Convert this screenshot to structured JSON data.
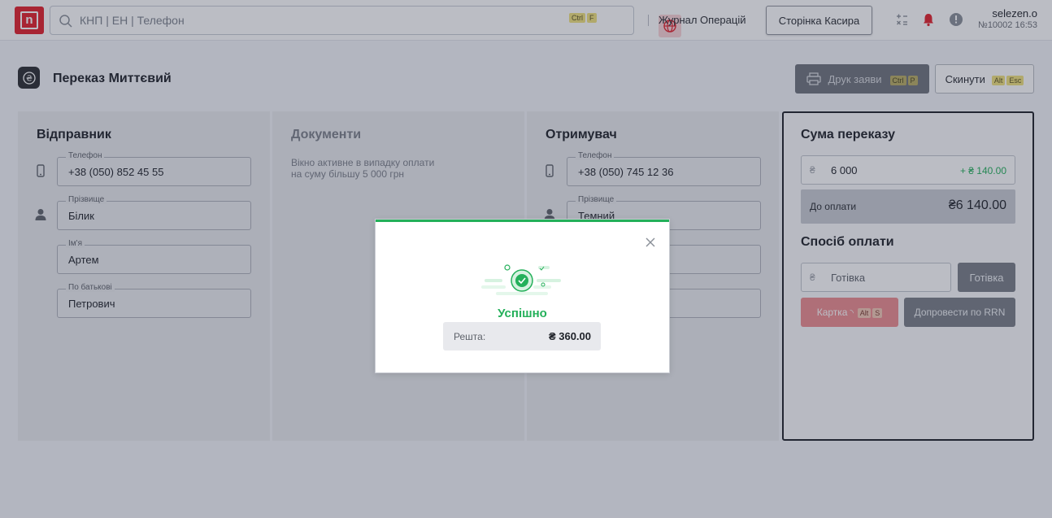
{
  "topbar": {
    "logo_letter": "n",
    "search_placeholder": "КНП | ЕН | Телефон",
    "search_shortcut": [
      "Ctrl",
      "F"
    ],
    "journal_link": "Журнал Операцій",
    "cashier_button": "Сторінка Касира",
    "user": {
      "name": "selezen.o",
      "sub": "№10002 16:53"
    }
  },
  "page": {
    "title": "Переказ Миттєвий",
    "print_button": {
      "label": "Друк заяви",
      "shortcut": [
        "Ctrl",
        "P"
      ]
    },
    "reset_button": {
      "label": "Скинути",
      "shortcut": [
        "Alt",
        "Esc"
      ]
    }
  },
  "sender": {
    "title": "Відправник",
    "phone": {
      "label": "Телефон",
      "value": "+38 (050) 852 45 55"
    },
    "surname": {
      "label": "Прізвище",
      "value": "Білик"
    },
    "name": {
      "label": "Ім'я",
      "value": "Артем"
    },
    "patronymic": {
      "label": "По батькові",
      "value": "Петрович"
    }
  },
  "documents": {
    "title": "Документи",
    "note_line1": "Вікно активне в випадку оплати",
    "note_line2": "на суму більшу 5 000 грн"
  },
  "recipient": {
    "title": "Отримувач",
    "phone": {
      "label": "Телефон",
      "value": "+38 (050) 745 12 36"
    },
    "surname": {
      "label": "Прізвище",
      "value": "Темний"
    }
  },
  "transfer": {
    "title": "Сума переказу",
    "currency_symbol": "₴",
    "amount": "6 000",
    "fee": "+ ₴ 140.00",
    "due_label": "До оплати",
    "due_value": "₴6 140.00",
    "payment_title": "Спосіб оплати",
    "payment_value": "Готівка",
    "cash_button": "Готівка",
    "card_button": "Картка",
    "card_shortcut": [
      "Alt",
      "S"
    ],
    "rrn_button": "Допровести по RRN"
  },
  "modal": {
    "title": "Успішно",
    "change_label": "Решта:",
    "change_value": "₴ 360.00"
  },
  "colors": {
    "brand_red": "#e3202a",
    "success_green": "#24b05a",
    "shortcut_yellow": "#f1e27c"
  }
}
